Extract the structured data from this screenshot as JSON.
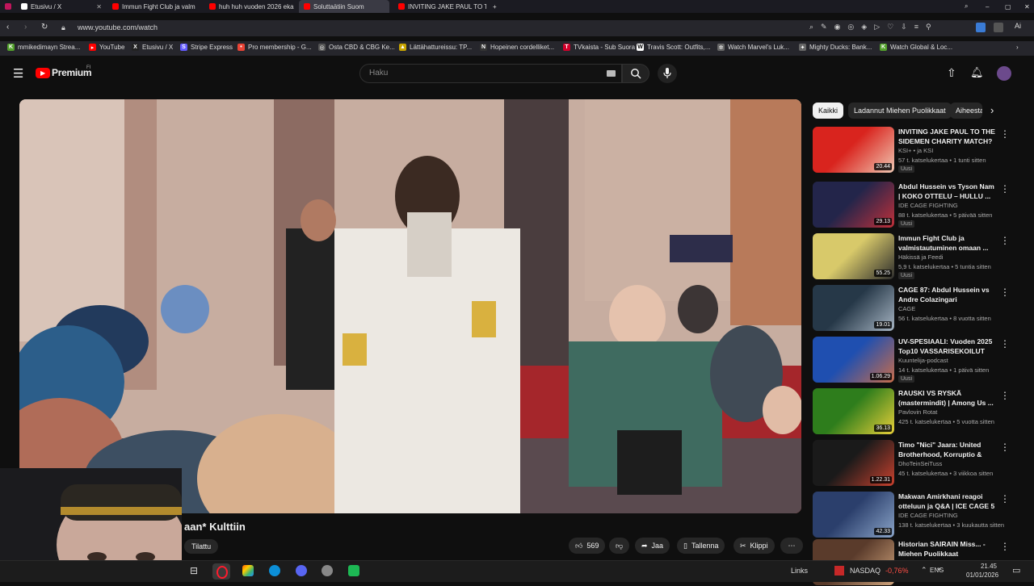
{
  "tabs": [
    {
      "title": "Etusivu / X",
      "color": "#ffffff"
    },
    {
      "title": "Immun Fight Club ja valm",
      "color": "#ff0000"
    },
    {
      "title": "huh huh vuoden 2026 eka",
      "color": "#ff0000"
    },
    {
      "title": "Soluttaätiin Suom",
      "color": "#ff0000"
    },
    {
      "title": "INVITING JAKE PAUL TO T",
      "color": "#ff0000"
    }
  ],
  "address": {
    "url": "www.youtube.com/watch"
  },
  "bookmarks": [
    {
      "label": "mmikedimayn Strea...",
      "color": "#53a12c"
    },
    {
      "label": "YouTube",
      "color": "#ff0000"
    },
    {
      "label": "Etusivu / X",
      "color": "#444444"
    },
    {
      "label": "Stripe Express",
      "color": "#635bff"
    },
    {
      "label": "Pro membership - G...",
      "color": "#ea4335"
    },
    {
      "label": "Osta CBD & CBG Ke...",
      "color": "#555555"
    },
    {
      "label": "Lättähattureissu: TP...",
      "color": "#c8a400"
    },
    {
      "label": "Hopeinen cordelliket...",
      "color": "#333333"
    },
    {
      "label": "TVkaista - Sub Suora",
      "color": "#d3002b"
    },
    {
      "label": "Travis Scott: Outfits,...",
      "color": "#ffffff"
    },
    {
      "label": "Watch Marvel's Luk...",
      "color": "#888888"
    },
    {
      "label": "Mighty Ducks: Bank...",
      "color": "#888888"
    },
    {
      "label": "Watch Global & Loc...",
      "color": "#53a12c"
    }
  ],
  "masthead": {
    "logo": "Premium",
    "region": "FI",
    "search_placeholder": "Haku"
  },
  "chips": [
    "Kaikki",
    "Ladannut Miehen Puolikkaat",
    "Aiheesta"
  ],
  "recommendations": [
    {
      "title": "INVITING JAKE PAUL TO THE SIDEMEN CHARITY MATCH?",
      "channel": "KSI+ • ja KSI",
      "meta": "57 t. katselukertaa • 1 tunti sitten",
      "badge": "Uusi",
      "duration": "20.44",
      "c1": "#d9241e",
      "c2": "#f0c7b2"
    },
    {
      "title": "Abdul Hussein vs Tyson Nam | KOKO OTTELU – HULLU ...",
      "channel": "IDE CAGE FIGHTING",
      "meta": "88 t. katselukertaa • 5 päivää sitten",
      "badge": "Uusi",
      "duration": "29.13",
      "c1": "#23254a",
      "c2": "#c0303a"
    },
    {
      "title": "Immun Fight Club ja valmistautuminen omaan ...",
      "channel": "Häkissä ja Feedi",
      "meta": "5,9 t. katselukertaa • 5 tuntia sitten",
      "badge": "Uusi",
      "duration": "55.25",
      "c1": "#d8c96a",
      "c2": "#2d2d2d"
    },
    {
      "title": "CAGE 87: Abdul Hussein vs Andre Colazingari",
      "channel": "CAGE",
      "meta": "56 t. katselukertaa • 8 vuotta sitten",
      "badge": "",
      "duration": "19.01",
      "c1": "#263848",
      "c2": "#a6b4c2"
    },
    {
      "title": "UV-SPESIAALI: Vuoden 2025 Top10 VASSARISEKOILUT",
      "channel": "Kuuntelija-podcast",
      "meta": "14 t. katselukertaa • 1 päivä sitten",
      "badge": "Uusi",
      "duration": "1.06.29",
      "c1": "#1f4fb0",
      "c2": "#c96d4b"
    },
    {
      "title": "RAUSKI VS RYSKÄ (mastermindit) | Among Us ...",
      "channel": "Pavlovin Rotat",
      "meta": "425 t. katselukertaa • 5 vuotta sitten",
      "badge": "",
      "duration": "36.13",
      "c1": "#2e7d1c",
      "c2": "#e8cf39"
    },
    {
      "title": "Timo \"Nici\" Jaara: United Brotherhood, Korruptio & Usko",
      "channel": "DhoTeinSeiTuss",
      "meta": "45 t. katselukertaa • 3 viikkoa sitten",
      "badge": "",
      "duration": "1.22.31",
      "c1": "#1a1a1a",
      "c2": "#c9412e"
    },
    {
      "title": "Makwan Amirkhani reagoi otteluun ja Q&A | ICE CAGE 5",
      "channel": "IDE CAGE FIGHTING",
      "meta": "138 t. katselukertaa • 3 kuukautta sitten",
      "badge": "",
      "duration": "42.33",
      "c1": "#2b3f6c",
      "c2": "#8aa4c8"
    },
    {
      "title": "Historian SAIRAIN Miss... - Miehen Puolikkaat",
      "channel": "",
      "meta": "",
      "badge": "",
      "duration": "",
      "c1": "#5a3b2b",
      "c2": "#d1a57d"
    }
  ],
  "video": {
    "title_fragment": "aan* Kulttiin",
    "subscribed": "Tilattu",
    "likes": "569",
    "share": "Jaa",
    "save": "Tallenna",
    "clip": "Klippi"
  },
  "taskbar": {
    "links": "Links",
    "ticker": "NASDAQ",
    "change": "-0,76%",
    "lang": "ENG",
    "time": "21.45",
    "date": "01/01/2026"
  },
  "colors": {
    "accent": "#ff0000",
    "background": "#0f0f0f",
    "negative": "#ff4e45"
  }
}
